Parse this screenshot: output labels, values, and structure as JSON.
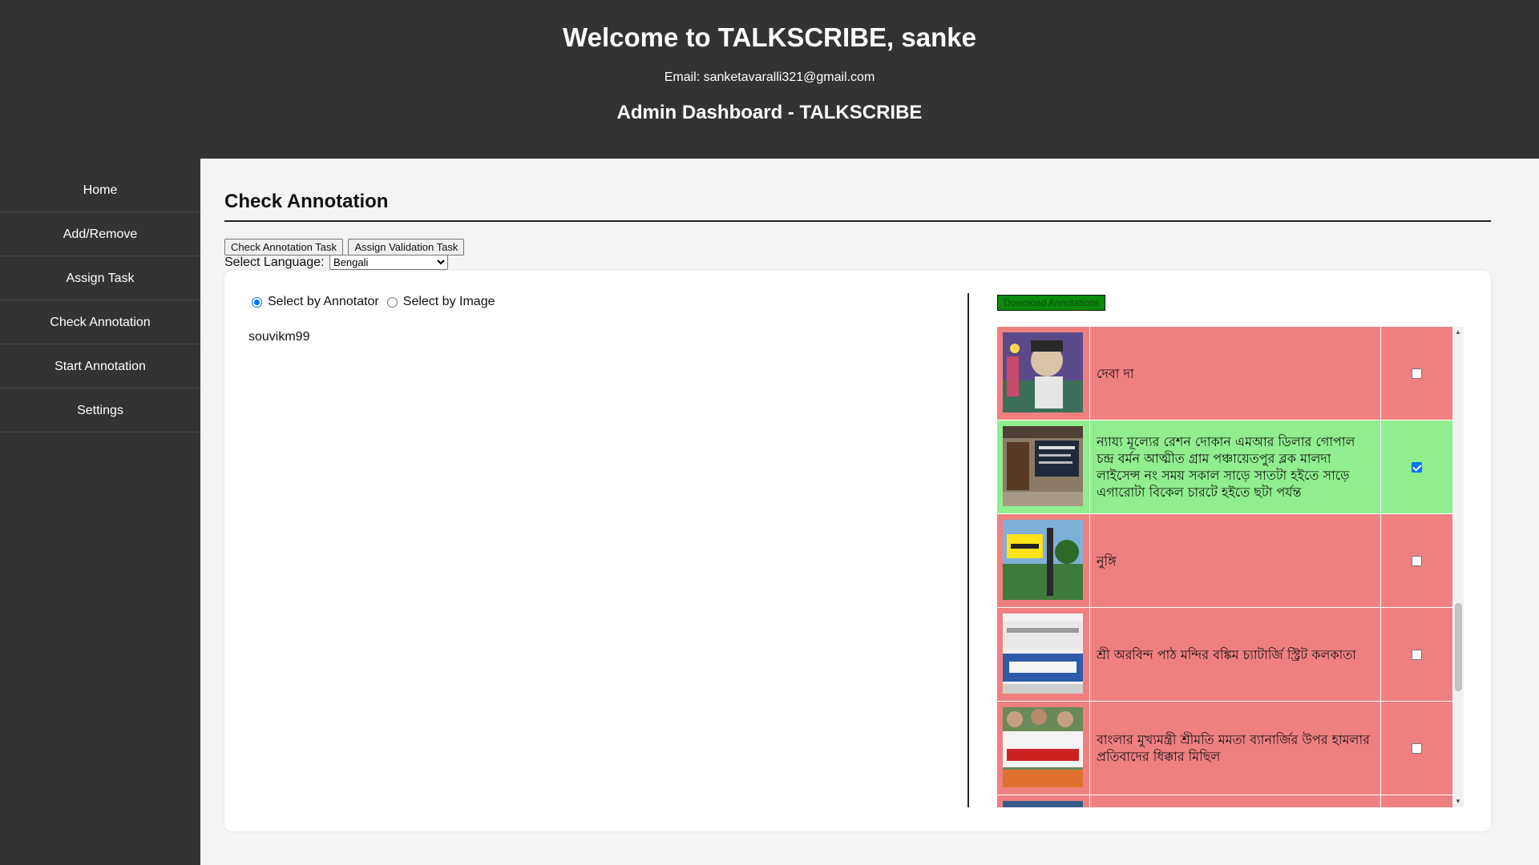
{
  "header": {
    "title": "Welcome to TALKSCRIBE, sanke",
    "email": "Email: sanketavaralli321@gmail.com",
    "subtitle": "Admin Dashboard - TALKSCRIBE"
  },
  "sidebar": {
    "items": [
      {
        "label": "Home"
      },
      {
        "label": "Add/Remove"
      },
      {
        "label": "Assign Task"
      },
      {
        "label": "Check Annotation"
      },
      {
        "label": "Start Annotation"
      },
      {
        "label": "Settings"
      }
    ]
  },
  "main": {
    "title": "Check Annotation",
    "buttons": {
      "check_annotation_task": "Check Annotation Task",
      "assign_validation_task": "Assign Validation Task"
    },
    "language": {
      "label": "Select Language:",
      "selected": "Bengali"
    },
    "filter": {
      "by_annotator": "Select by Annotator",
      "by_image": "Select by Image",
      "selected": "annotator"
    },
    "annotator": "souvikm99",
    "download_label": "Download Annotations",
    "annotations": [
      {
        "text": "দেবা দা",
        "status": "red",
        "checked": false,
        "thumb": "mural"
      },
      {
        "text": "ন্যায্য মূল্যের রেশন দোকান এমআর ডিলার গোপাল চন্দ্র বর্মন আত্মীত গ্রাম পঞ্চায়েতপুর ব্লক মালদা লাইসেন্স নং সময় সকাল সাড়ে সাতটা হইতে সাড়ে এগারোটা বিকেল চারটে হইতে ছটা পর্যন্ত",
        "status": "green",
        "checked": true,
        "thumb": "shop"
      },
      {
        "text": "নুঙ্গি",
        "status": "red",
        "checked": false,
        "thumb": "station"
      },
      {
        "text": "শ্রী অরবিন্দ পাঠ মন্দির বঙ্কিম চ্যাটার্জি স্ট্রিট কলকাতা",
        "status": "red",
        "checked": false,
        "thumb": "signboard"
      },
      {
        "text": "বাংলার মুখ্যমন্ত্রী শ্রীমতি মমতা ব্যানার্জির উপর হামলার প্রতিবাদের ধিক্কার মিছিল",
        "status": "red",
        "checked": false,
        "thumb": "rally"
      },
      {
        "text": "",
        "status": "red",
        "checked": false,
        "thumb": "blank"
      }
    ],
    "colors": {
      "row_red": "#f08080",
      "row_green": "#90ee90",
      "header_bg": "#333333",
      "download_bg": "#0b8a0b"
    }
  }
}
